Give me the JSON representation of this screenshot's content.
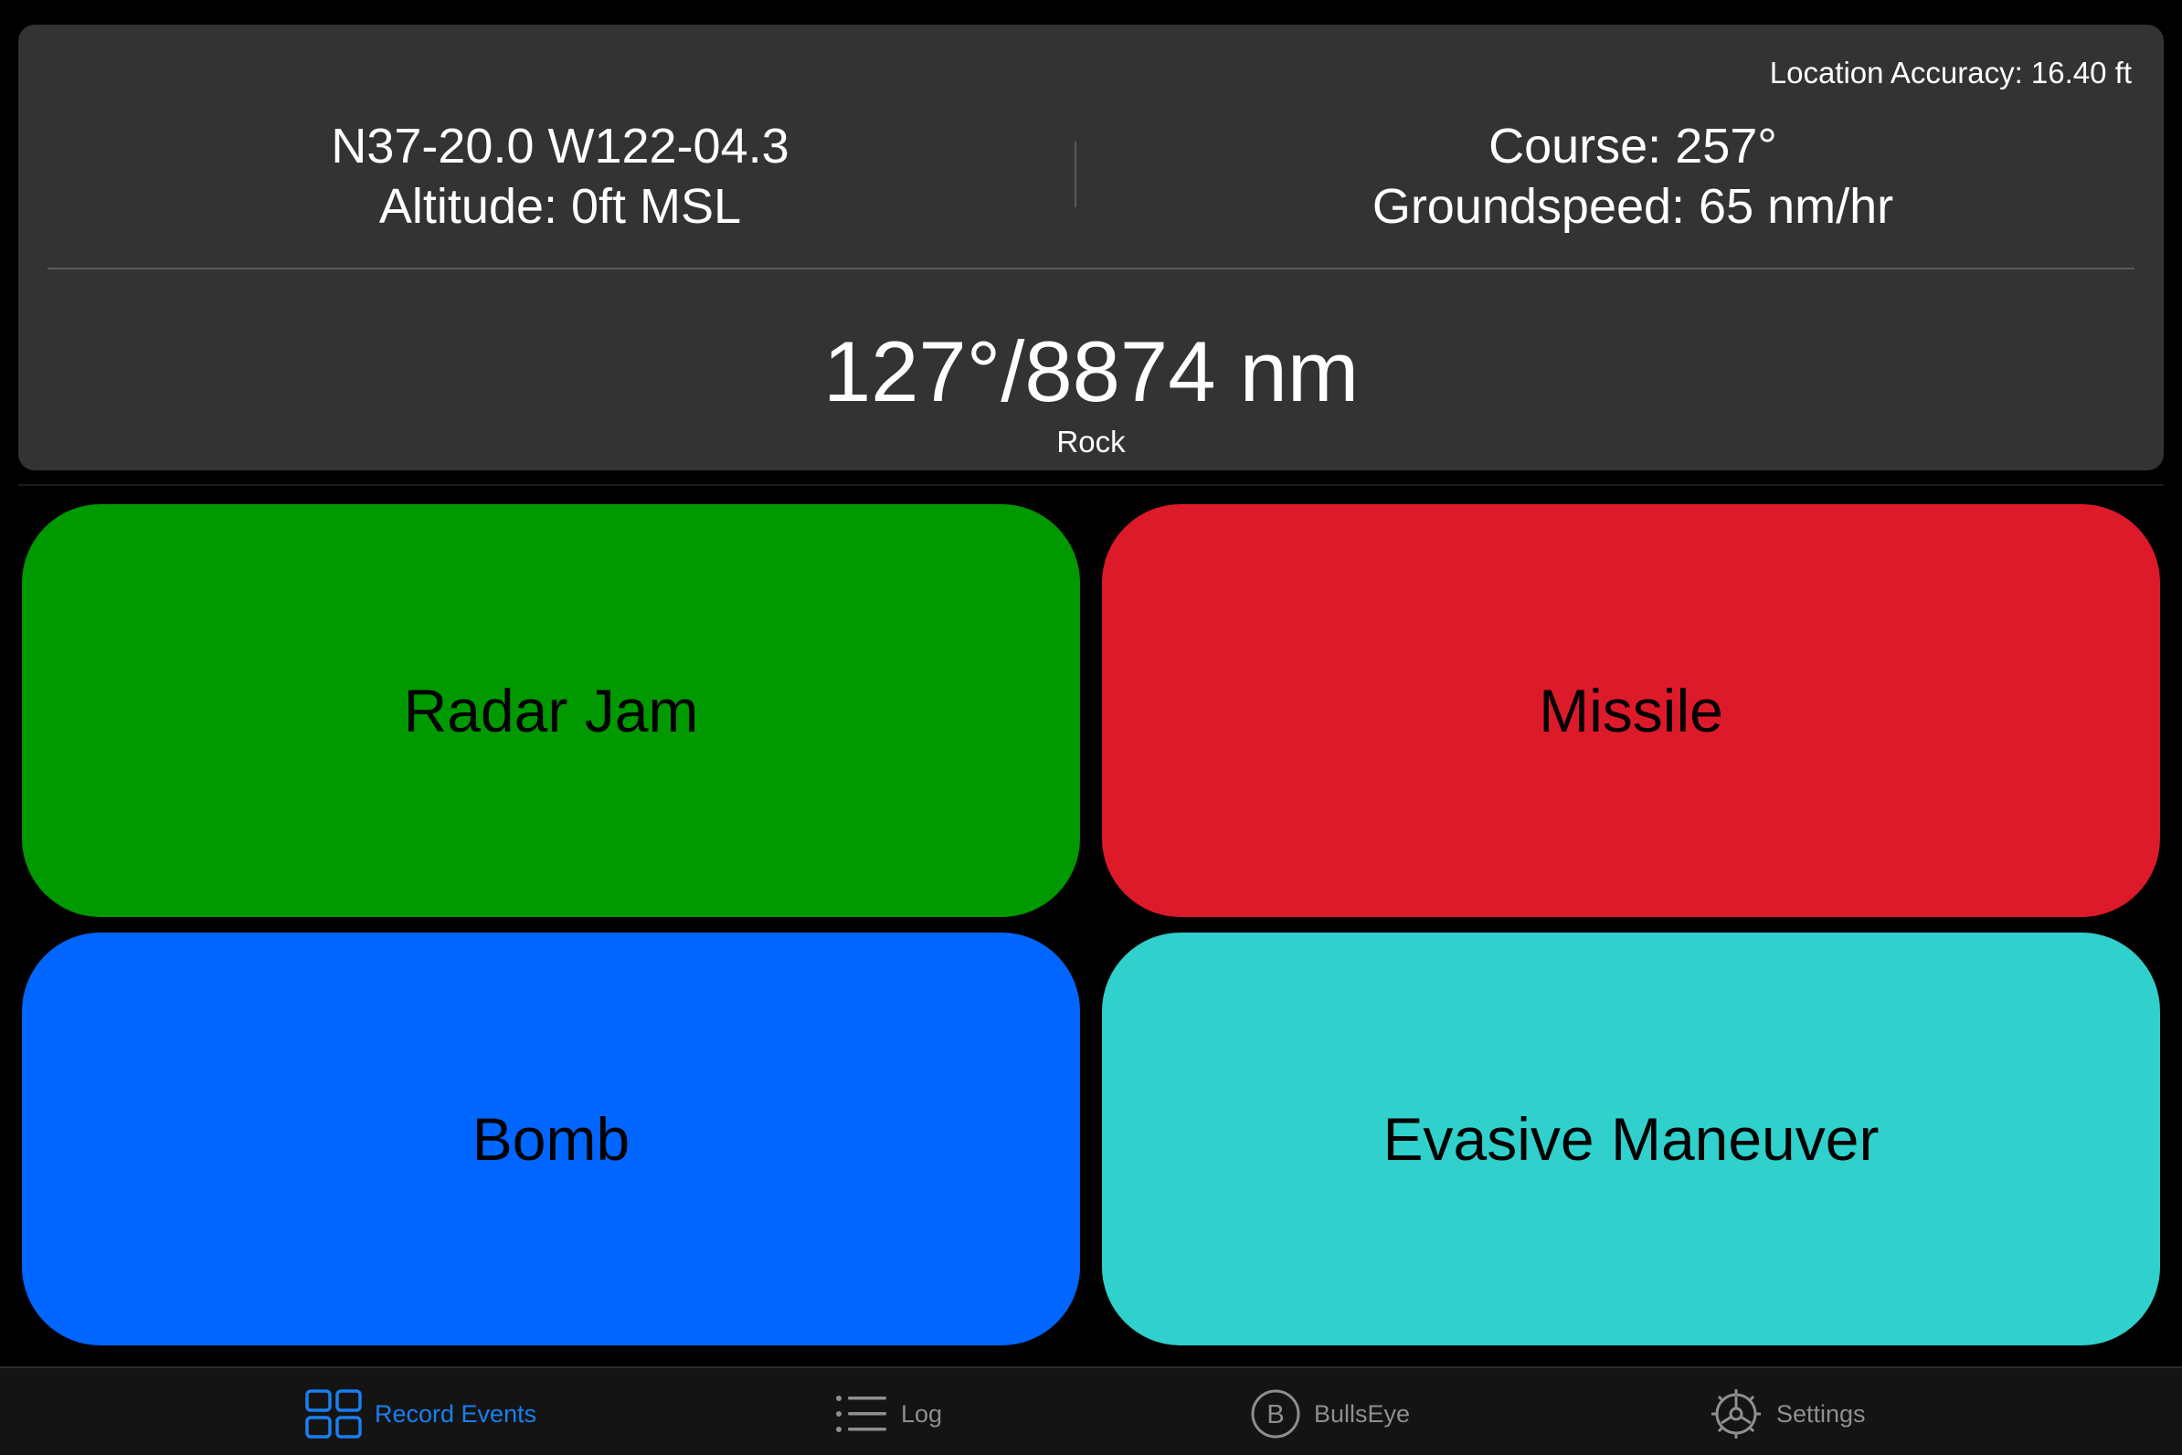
{
  "info": {
    "accuracy": "Location Accuracy: 16.40 ft",
    "position": "N37-20.0 W122-04.3",
    "altitude": "Altitude: 0ft MSL",
    "course": "Course: 257°",
    "groundspeed": "Groundspeed: 65 nm/hr",
    "bearing": "127°/8874 nm",
    "target": "Rock"
  },
  "events": [
    {
      "label": "Radar Jam",
      "color": "#009900"
    },
    {
      "label": "Missile",
      "color": "#dd1a2a"
    },
    {
      "label": "Bomb",
      "color": "#0066ff"
    },
    {
      "label": "Evasive Maneuver",
      "color": "#30d0cc"
    }
  ],
  "tabs": [
    {
      "label": "Record Events",
      "icon": "grid-icon",
      "active": true
    },
    {
      "label": "Log",
      "icon": "list-icon",
      "active": false
    },
    {
      "label": "BullsEye",
      "icon": "bullseye-b-icon",
      "active": false
    },
    {
      "label": "Settings",
      "icon": "gear-icon",
      "active": false
    }
  ],
  "colors": {
    "accent": "#1a7ff0",
    "panel": "#333333",
    "inactive_tab": "#8e8e93"
  }
}
